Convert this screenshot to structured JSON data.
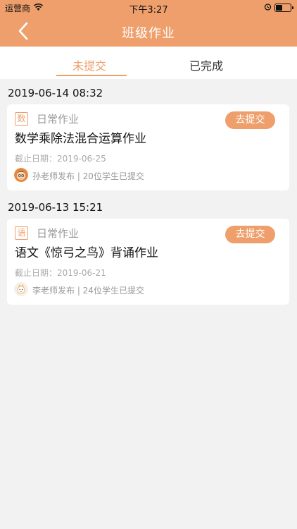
{
  "status_bar": {
    "carrier": "运营商",
    "time": "下午3:27",
    "battery_level": 0.45
  },
  "nav": {
    "title": "班级作业",
    "back_icon": "chevron-left-icon"
  },
  "tabs": [
    {
      "label": "未提交",
      "active": true
    },
    {
      "label": "已完成",
      "active": false
    }
  ],
  "colors": {
    "accent": "#ee9f6c",
    "background": "#f2f2f2"
  },
  "groups": [
    {
      "date": "2019-06-14 08:32",
      "card": {
        "subject": "数",
        "type": "日常作业",
        "action": "去提交",
        "title": "数学乘除法混合运算作业",
        "deadline": "截止日期：2019-06-25",
        "publisher": "孙老师发布 | 20位学生已提交"
      }
    },
    {
      "date": "2019-06-13 15:21",
      "card": {
        "subject": "语",
        "type": "日常作业",
        "action": "去提交",
        "title": "语文《惊弓之鸟》背诵作业",
        "deadline": "截止日期：2019-06-21",
        "publisher": "李老师发布 | 24位学生已提交"
      }
    }
  ]
}
